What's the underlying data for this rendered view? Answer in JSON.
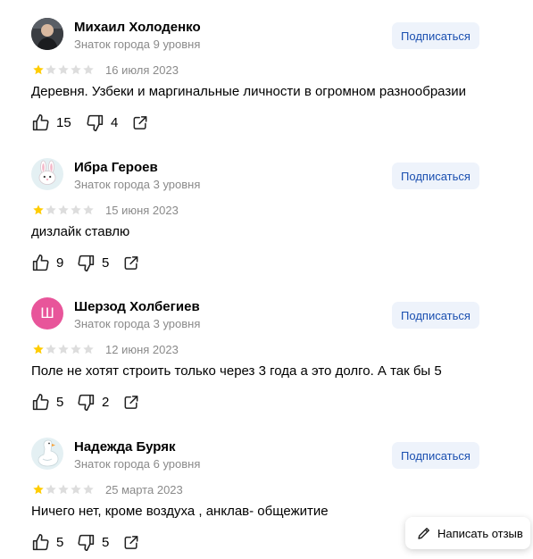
{
  "subscribe_label": "Подписаться",
  "write_review_label": "Написать отзыв",
  "colors": {
    "star_filled": "#fc0",
    "star_empty": "#ddd",
    "subscribe_bg": "#eef3fb",
    "subscribe_text": "#1a4fb0",
    "muted_text": "#8a8a8a",
    "letter_avatar_bg": "#e8559a"
  },
  "reviews": [
    {
      "author": "Михаил Холоденко",
      "level": "Знаток города 9 уровня",
      "avatar": "user-photo-icon",
      "rating": 1,
      "rating_max": 5,
      "date": "16 июля 2023",
      "text": "Деревня. Узбеки и маргинальные личности в огромном разнообразии",
      "likes": "15",
      "dislikes": "4"
    },
    {
      "author": "Ибра Героев",
      "level": "Знаток города 3 уровня",
      "avatar": "rabbit-icon",
      "rating": 1,
      "rating_max": 5,
      "date": "15 июня 2023",
      "text": "дизлайк ставлю",
      "likes": "9",
      "dislikes": "5"
    },
    {
      "author": "Шерзод Холбегиев",
      "level": "Знаток города 3 уровня",
      "avatar": "Ш",
      "rating": 1,
      "rating_max": 5,
      "date": "12 июня 2023",
      "text": "Поле не хотят строить только через 3 года а это долго. А так бы 5",
      "likes": "5",
      "dislikes": "2"
    },
    {
      "author": "Надежда Буряк",
      "level": "Знаток города 6 уровня",
      "avatar": "goose-icon",
      "rating": 1,
      "rating_max": 5,
      "date": "25 марта 2023",
      "text": "Ничего нет, кроме воздуха , анклав- общежитие",
      "likes": "5",
      "dislikes": "5"
    }
  ]
}
